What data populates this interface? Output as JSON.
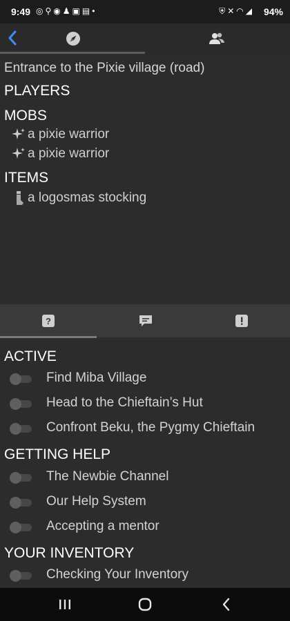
{
  "status_bar": {
    "time": "9:49",
    "battery": "94%",
    "left_icons": [
      "whatsapp-icon",
      "location-icon",
      "discord-icon",
      "snapchat-icon",
      "chat-icon",
      "notification-icon",
      "more-dot"
    ],
    "right_icons": [
      "vpn-icon",
      "mute-icon",
      "wifi-icon",
      "signal-icon"
    ]
  },
  "top_bar": {
    "back_icon": "chevron-left-icon",
    "tabs": [
      {
        "icon": "compass-icon",
        "selected": true
      },
      {
        "icon": "people-icon",
        "selected": false
      }
    ]
  },
  "room": {
    "title": "Entrance to the Pixie village (road)",
    "players_heading": "PLAYERS",
    "mobs_heading": "MOBS",
    "mobs": [
      {
        "icon": "sparkle-icon",
        "name": "a pixie warrior"
      },
      {
        "icon": "sparkle-icon",
        "name": "a pixie warrior"
      }
    ],
    "items_heading": "ITEMS",
    "items": [
      {
        "icon": "stocking-icon",
        "name": "a logosmas stocking"
      }
    ]
  },
  "lower_tabs": [
    {
      "icon": "question-icon",
      "selected": true
    },
    {
      "icon": "message-icon",
      "selected": false
    },
    {
      "icon": "alert-icon",
      "selected": false
    }
  ],
  "tasks": {
    "sections": [
      {
        "heading": "ACTIVE",
        "items": [
          "Find Miba Village",
          "Head to the Chieftain’s Hut",
          "Confront Beku, the Pygmy Chieftain"
        ]
      },
      {
        "heading": "GETTING HELP",
        "items": [
          "The Newbie Channel",
          "Our Help System",
          "Accepting a mentor"
        ]
      },
      {
        "heading": "YOUR INVENTORY",
        "items": [
          "Checking Your Inventory"
        ]
      }
    ]
  },
  "nav_bar": [
    "recents-icon",
    "home-icon",
    "back-icon"
  ],
  "colors": {
    "accent": "#3e8ef7",
    "background": "#2c2c2c",
    "tab_bar": "#3a3a3a",
    "toggle_off": "#5f5f5f"
  }
}
